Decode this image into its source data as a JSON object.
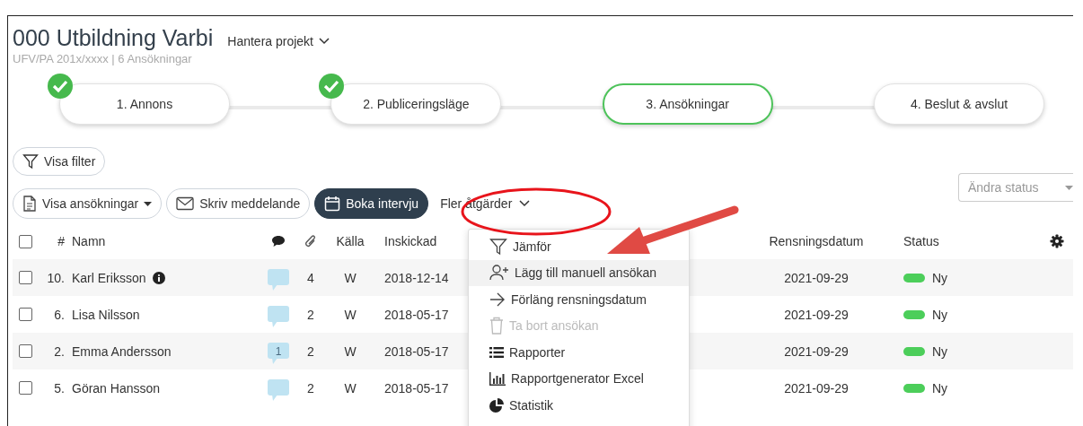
{
  "header": {
    "title": "000 Utbildning Varbi",
    "manage_menu": "Hantera projekt",
    "subtitle": "UFV/PA 201x/xxxx | 6 Ansökningar"
  },
  "steps": [
    {
      "label": "1. Annons",
      "done": true,
      "selected": false
    },
    {
      "label": "2. Publiceringsläge",
      "done": true,
      "selected": false
    },
    {
      "label": "3. Ansökningar",
      "done": false,
      "selected": true
    },
    {
      "label": "4. Beslut & avslut",
      "done": false,
      "selected": false
    }
  ],
  "filter_button": "Visa filter",
  "toolbar": [
    {
      "kind": "outline",
      "label": "Visa ansökningar",
      "caret": true
    },
    {
      "kind": "outline",
      "label": "Skriv meddelande",
      "caret": false
    },
    {
      "kind": "dark",
      "label": "Boka intervju",
      "caret": false
    },
    {
      "kind": "plain",
      "label": "Fler åtgärder",
      "caret": true
    }
  ],
  "status_select": {
    "placeholder": "Ändra status"
  },
  "table": {
    "select_all_checked": false,
    "columns": [
      "#",
      "Namn",
      "Källa",
      "Inskickad",
      "Rensningsdatum",
      "Status"
    ],
    "rows": [
      {
        "checked": false,
        "number": "10.",
        "name": "Karl Eriksson",
        "info": true,
        "attachments": "4",
        "source": "W",
        "submitted": "2018-12-14",
        "cleanup": "2021-09-29",
        "status": "Ny",
        "color": "#4cce5a"
      },
      {
        "checked": false,
        "number": "6.",
        "name": "Lisa Nilsson",
        "attachments": "2",
        "source": "W",
        "submitted": "2018-05-17",
        "cleanup": "2021-09-29",
        "status": "Ny",
        "color": "#4cce5a"
      },
      {
        "checked": false,
        "number": "2.",
        "name": "Emma Andersson",
        "comments": "1",
        "attachments": "2",
        "source": "W",
        "submitted": "2018-05-17",
        "cleanup": "2021-09-29",
        "status": "Ny",
        "color": "#4cce5a"
      },
      {
        "checked": false,
        "number": "5.",
        "name": "Göran Hansson",
        "attachments": "2",
        "source": "W",
        "submitted": "2018-05-17",
        "cleanup": "2021-09-29",
        "status": "Ny",
        "color": "#4cce5a"
      }
    ]
  },
  "actions_menu": [
    {
      "kind": "filter",
      "label": "Jämför",
      "highlighted": false,
      "disabled": false
    },
    {
      "kind": "person-add",
      "label": "Lägg till manuell ansökan",
      "highlighted": true,
      "disabled": false
    },
    {
      "kind": "arrow",
      "label": "Förläng rensningsdatum",
      "highlighted": false,
      "disabled": false
    },
    {
      "kind": "trash",
      "label": "Ta bort ansökan",
      "highlighted": false,
      "disabled": true
    },
    {
      "kind": "list",
      "label": "Rapporter",
      "highlighted": false,
      "disabled": false
    },
    {
      "kind": "bars",
      "label": "Rapportgenerator Excel",
      "highlighted": false,
      "disabled": false
    },
    {
      "kind": "pie",
      "label": "Statistik",
      "highlighted": false,
      "disabled": false
    }
  ]
}
